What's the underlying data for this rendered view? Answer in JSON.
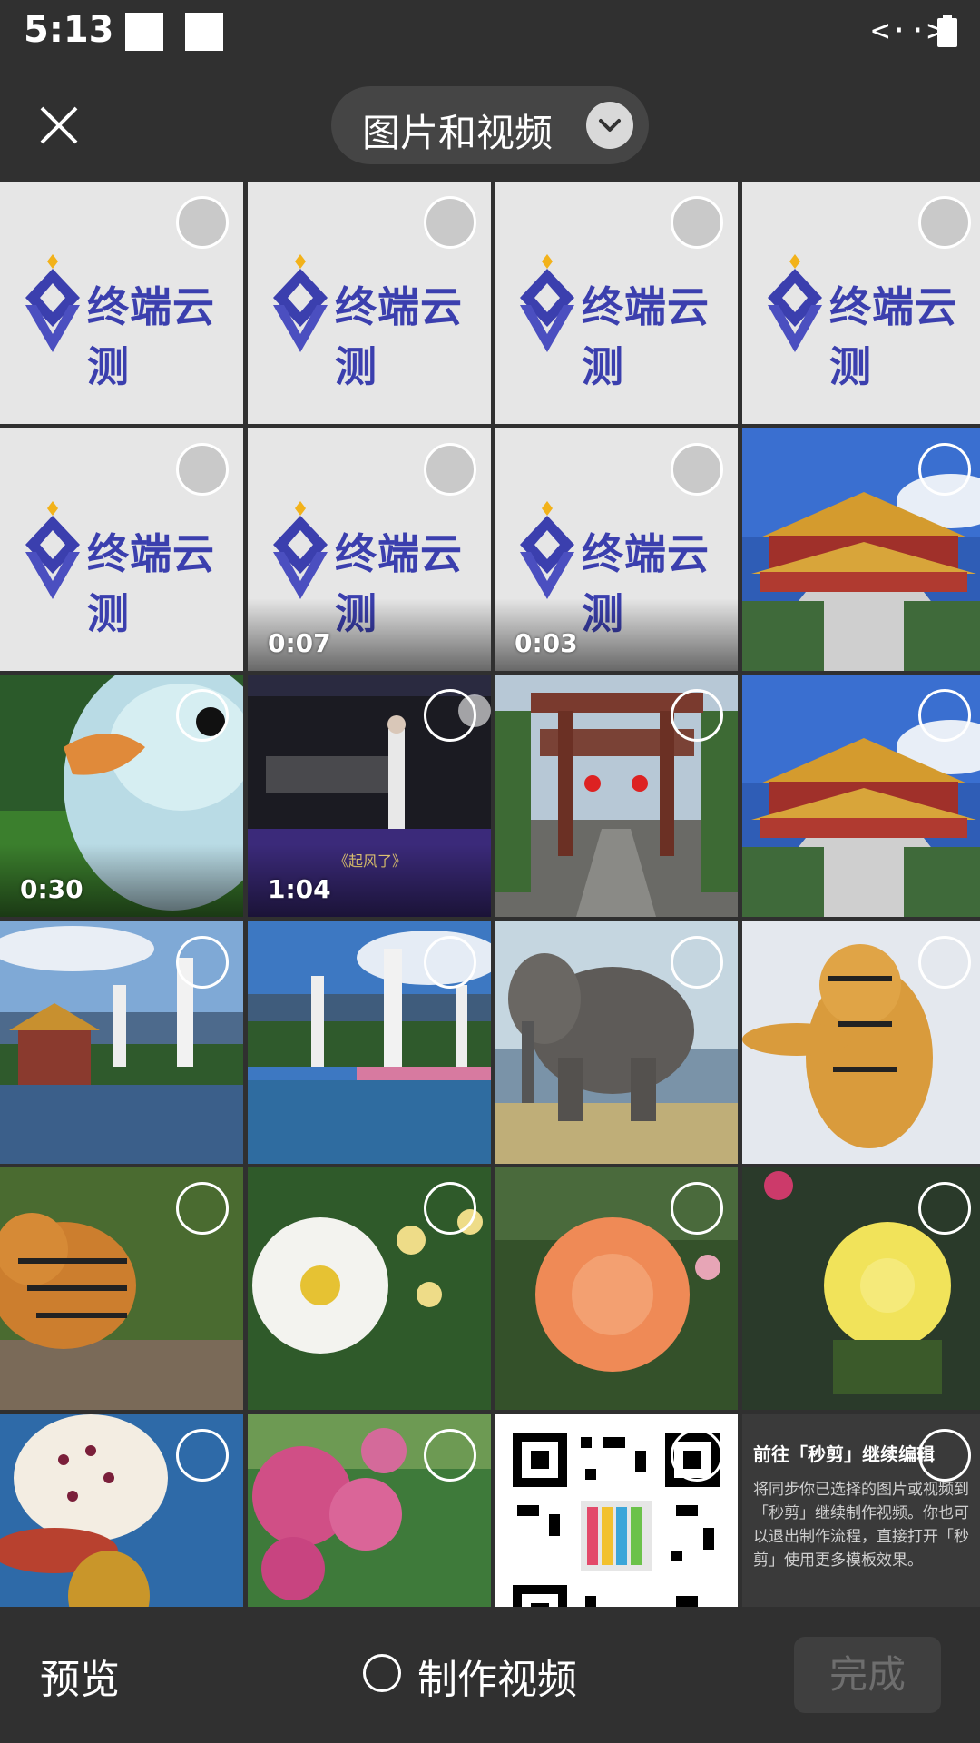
{
  "status_bar": {
    "time": "5:13"
  },
  "header": {
    "title": "图片和视频"
  },
  "logo_text": "终端云测",
  "grid": {
    "tiles": [
      {
        "kind": "logo",
        "duration": ""
      },
      {
        "kind": "logo",
        "duration": ""
      },
      {
        "kind": "logo",
        "duration": ""
      },
      {
        "kind": "logo",
        "duration": ""
      },
      {
        "kind": "logo",
        "duration": ""
      },
      {
        "kind": "logo",
        "duration": "0:07"
      },
      {
        "kind": "logo",
        "duration": "0:03"
      },
      {
        "kind": "photo",
        "subject": "temple",
        "duration": ""
      },
      {
        "kind": "photo",
        "subject": "bird",
        "duration": "0:30"
      },
      {
        "kind": "photo",
        "subject": "concert",
        "duration": "1:04",
        "caption": "《起风了》"
      },
      {
        "kind": "photo",
        "subject": "gate",
        "duration": ""
      },
      {
        "kind": "photo",
        "subject": "temple",
        "duration": ""
      },
      {
        "kind": "photo",
        "subject": "pagoda-lake",
        "duration": ""
      },
      {
        "kind": "photo",
        "subject": "pagoda-lake-2",
        "duration": ""
      },
      {
        "kind": "photo",
        "subject": "elephant",
        "duration": ""
      },
      {
        "kind": "photo",
        "subject": "tiger-snow",
        "duration": ""
      },
      {
        "kind": "photo",
        "subject": "tiger",
        "duration": ""
      },
      {
        "kind": "photo",
        "subject": "white-rose",
        "duration": ""
      },
      {
        "kind": "photo",
        "subject": "orange-rose",
        "duration": ""
      },
      {
        "kind": "photo",
        "subject": "yellow-rose",
        "duration": ""
      },
      {
        "kind": "photo",
        "subject": "orchid",
        "duration": ""
      },
      {
        "kind": "photo",
        "subject": "pink-flowers",
        "duration": ""
      },
      {
        "kind": "photo",
        "subject": "qr-code",
        "duration": ""
      },
      {
        "kind": "promo",
        "duration": ""
      }
    ]
  },
  "promo": {
    "title": "前往「秒剪」继续编辑",
    "body": "将同步你已选择的图片或视频到「秒剪」继续制作视频。你也可以退出制作流程，直接打开「秒剪」使用更多模板效果。"
  },
  "bottom_bar": {
    "preview_label": "预览",
    "make_video_label": "制作视频",
    "done_label": "完成"
  }
}
